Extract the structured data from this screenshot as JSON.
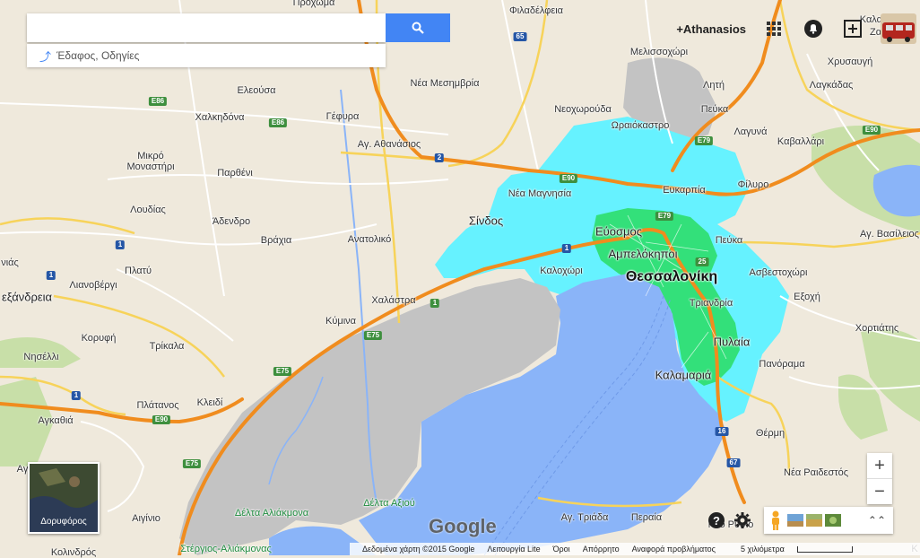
{
  "search": {
    "placeholder": "",
    "value": ""
  },
  "directions_hint": "Έδαφος, Οδηγίες",
  "user": {
    "name": "+Athanasios"
  },
  "map_labels": [
    {
      "id": "prochoma",
      "text": "Πρόχωμα",
      "kind": "normal"
    },
    {
      "id": "filadelfeia",
      "text": "Φιλαδέλφεια",
      "kind": "normal"
    },
    {
      "id": "melissochori",
      "text": "Μελισσοχώρι",
      "kind": "normal"
    },
    {
      "id": "chrysavgi",
      "text": "Χρυσαυγή",
      "kind": "normal"
    },
    {
      "id": "kalamoto",
      "text": "Καλαμωτό",
      "kind": "normal"
    },
    {
      "id": "zagkliveri",
      "text": "Ζαγκλιβέρι",
      "kind": "normal"
    },
    {
      "id": "lagkadas",
      "text": "Λαγκάδας",
      "kind": "normal"
    },
    {
      "id": "lliti",
      "text": "Λητή",
      "kind": "normal"
    },
    {
      "id": "nea_mesimvria",
      "text": "Νέα Μεσημβρία",
      "kind": "normal"
    },
    {
      "id": "eleousa",
      "text": "Ελεούσα",
      "kind": "normal"
    },
    {
      "id": "chalkidona",
      "text": "Χαλκηδόνα",
      "kind": "normal"
    },
    {
      "id": "gefyra",
      "text": "Γέφυρα",
      "kind": "normal"
    },
    {
      "id": "neochorouda",
      "text": "Νεοχωρούδα",
      "kind": "normal"
    },
    {
      "id": "oraiokastro",
      "text": "Ωραιόκαστρο",
      "kind": "normal"
    },
    {
      "id": "pefka0",
      "text": "Πεύκα",
      "kind": "normal"
    },
    {
      "id": "lagkadas2",
      "text": "Λαγυνά",
      "kind": "normal"
    },
    {
      "id": "kavallari",
      "text": "Καβαλλάρι",
      "kind": "normal"
    },
    {
      "id": "ag_athanasios",
      "text": "Αγ. Αθανάσιος",
      "kind": "normal"
    },
    {
      "id": "mikro_monastiri",
      "text": "Μικρό\nΜοναστήρι",
      "kind": "normal"
    },
    {
      "id": "parthenι",
      "text": "Παρθένι",
      "kind": "normal"
    },
    {
      "id": "nea_magnisia",
      "text": "Νέα Μαγνησία",
      "kind": "normal"
    },
    {
      "id": "evkarpia",
      "text": "Ευκαρπία",
      "kind": "normal"
    },
    {
      "id": "filyro",
      "text": "Φίλυρο",
      "kind": "normal"
    },
    {
      "id": "loudias",
      "text": "Λουδίας",
      "kind": "normal"
    },
    {
      "id": "adendro",
      "text": "Άδενδρο",
      "kind": "normal"
    },
    {
      "id": "sindos",
      "text": "Σίνδος",
      "kind": "big"
    },
    {
      "id": "evosmos",
      "text": "Εύοσμος",
      "kind": "big"
    },
    {
      "id": "pefka",
      "text": "Πεύκα",
      "kind": "normal"
    },
    {
      "id": "ag_vasileios",
      "text": "Αγ. Βασίλειος",
      "kind": "normal"
    },
    {
      "id": "vrachia",
      "text": "Βράχια",
      "kind": "normal"
    },
    {
      "id": "anatoliko",
      "text": "Ανατολικό",
      "kind": "normal"
    },
    {
      "id": "ampelokipoi",
      "text": "Αμπελόκηποι",
      "kind": "big"
    },
    {
      "id": "nias",
      "text": "νιάς",
      "kind": "normal"
    },
    {
      "id": "platy",
      "text": "Πλατύ",
      "kind": "normal"
    },
    {
      "id": "kalochori",
      "text": "Καλοχώρι",
      "kind": "normal"
    },
    {
      "id": "thessaloniki",
      "text": "Θεσσαλονίκη",
      "kind": "city"
    },
    {
      "id": "asvestochori",
      "text": "Ασβεστοχώρι",
      "kind": "normal"
    },
    {
      "id": "alexandreia",
      "text": "εξάνδρεια",
      "kind": "big"
    },
    {
      "id": "lianovergi",
      "text": "Λιανοβέργι",
      "kind": "normal"
    },
    {
      "id": "chalastra",
      "text": "Χαλάστρα",
      "kind": "normal"
    },
    {
      "id": "exochi",
      "text": "Εξοχή",
      "kind": "normal"
    },
    {
      "id": "triandria",
      "text": "Τριανδρία",
      "kind": "normal"
    },
    {
      "id": "kymina",
      "text": "Κύμινα",
      "kind": "normal"
    },
    {
      "id": "chortiatis",
      "text": "Χορτιάτης",
      "kind": "normal"
    },
    {
      "id": "korifi",
      "text": "Κορυφή",
      "kind": "normal"
    },
    {
      "id": "trikala",
      "text": "Τρίκαλα",
      "kind": "normal"
    },
    {
      "id": "pylaia",
      "text": "Πυλαία",
      "kind": "big"
    },
    {
      "id": "nisellai",
      "text": "Νησέλλι",
      "kind": "normal"
    },
    {
      "id": "panorama",
      "text": "Πανόραμα",
      "kind": "normal"
    },
    {
      "id": "kalamaria",
      "text": "Καλαμαριά",
      "kind": "big"
    },
    {
      "id": "platanos",
      "text": "Πλάτανος",
      "kind": "normal"
    },
    {
      "id": "kleidi",
      "text": "Κλειδί",
      "kind": "normal"
    },
    {
      "id": "agkathia",
      "text": "Αγκαθιά",
      "kind": "normal"
    },
    {
      "id": "thermi",
      "text": "Θέρμη",
      "kind": "normal"
    },
    {
      "id": "a_edge",
      "text": "Αγ",
      "kind": "normal"
    },
    {
      "id": "nea_raidestos",
      "text": "Νέα Ραιδεστός",
      "kind": "normal"
    },
    {
      "id": "delta_aliakmona",
      "text": "Δέλτα Αλιάκμονα",
      "kind": "green"
    },
    {
      "id": "delta_axiou",
      "text": "Δέλτα Αξιού",
      "kind": "green"
    },
    {
      "id": "aiginio",
      "text": "Αιγίνιο",
      "kind": "normal"
    },
    {
      "id": "ag_triada",
      "text": "Αγ. Τριάδα",
      "kind": "normal"
    },
    {
      "id": "peraia",
      "text": "Περαία",
      "kind": "normal"
    },
    {
      "id": "neo_rysio",
      "text": "Νέο Ρύσιο",
      "kind": "normal"
    },
    {
      "id": "stergios",
      "text": "Στέργιος-Αλιάκμονας",
      "kind": "green"
    },
    {
      "id": "kolindros",
      "text": "Κολινδρός",
      "kind": "normal"
    },
    {
      "id": "kavakli",
      "text": "Κ",
      "kind": "normal"
    }
  ],
  "road_shields": [
    {
      "id": "s65",
      "text": "65",
      "type": "n"
    },
    {
      "id": "s2",
      "text": "2",
      "type": "n"
    },
    {
      "id": "sE86a",
      "text": "E86",
      "type": "e"
    },
    {
      "id": "sE86b",
      "text": "E86",
      "type": "e"
    },
    {
      "id": "sE79",
      "text": "E79",
      "type": "e"
    },
    {
      "id": "sE90a",
      "text": "E90",
      "type": "e"
    },
    {
      "id": "sE90b",
      "text": "E90",
      "type": "e"
    },
    {
      "id": "sE79b",
      "text": "E79",
      "type": "e"
    },
    {
      "id": "s1a",
      "text": "1",
      "type": "n"
    },
    {
      "id": "s1b",
      "text": "1",
      "type": "n"
    },
    {
      "id": "s1c",
      "text": "1",
      "type": "n"
    },
    {
      "id": "s1d",
      "text": "1",
      "type": "e"
    },
    {
      "id": "s1e",
      "text": "1",
      "type": "n"
    },
    {
      "id": "s25",
      "text": "25",
      "type": "e"
    },
    {
      "id": "sE75a",
      "text": "E75",
      "type": "e"
    },
    {
      "id": "sE75b",
      "text": "E75",
      "type": "e"
    },
    {
      "id": "sE75c",
      "text": "E75",
      "type": "e"
    },
    {
      "id": "sE90c",
      "text": "E90",
      "type": "e"
    },
    {
      "id": "s16",
      "text": "16",
      "type": "n"
    },
    {
      "id": "s67",
      "text": "67",
      "type": "n"
    }
  ],
  "controls": {
    "zoom_in": "+",
    "zoom_out": "−",
    "satellite_label": "Δορυφόρος",
    "help": "?",
    "expand": "⌃⌃"
  },
  "watermark": "Google",
  "footer": {
    "data": "Δεδομένα χάρτη ©2015 Google",
    "lite": "Λειτουργία Lite",
    "terms": "Όροι",
    "privacy": "Απόρρητο",
    "report": "Αναφορά προβλήματος",
    "scale": "5 χιλιόμετρα"
  },
  "colors": {
    "land": "#efe9dc",
    "sea": "#8ab4f8",
    "coverage_outer": "#66f2ff",
    "coverage_inner": "#33e07a",
    "delta": "#bdbdbd",
    "motorway": "#f08c1e",
    "park": "#c8dfa8",
    "accent": "#4285f4"
  }
}
